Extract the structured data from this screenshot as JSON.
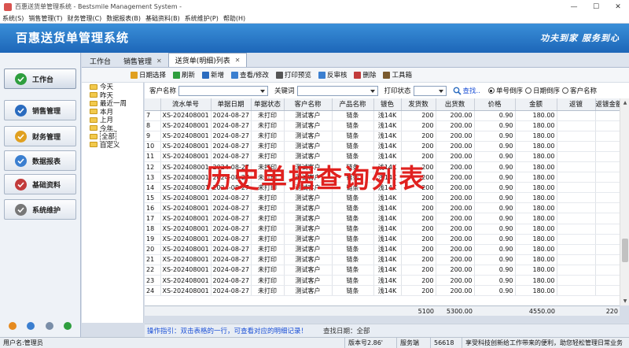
{
  "window": {
    "title": "百惠送货单管理系统 - Bestsmile Management System -",
    "min": "—",
    "max": "☐",
    "close": "✕"
  },
  "menu": [
    "系统(S)",
    "销售管理(T)",
    "财务管理(C)",
    "数据报表(B)",
    "基础资料(B)",
    "系统维护(P)",
    "帮助(H)"
  ],
  "banner": {
    "title": "百惠送货单管理系统",
    "slogan": "功夫到家 服务到心"
  },
  "nav": [
    {
      "label": "工作台",
      "icon": "check-circle-icon",
      "color": "#2e9e3e"
    },
    {
      "label": "销售管理",
      "icon": "cart-icon",
      "color": "#2a6bbf"
    },
    {
      "label": "财务管理",
      "icon": "folder-icon",
      "color": "#e0a020"
    },
    {
      "label": "数据报表",
      "icon": "magnifier-icon",
      "color": "#3b7fd0"
    },
    {
      "label": "基础资料",
      "icon": "user-icon",
      "color": "#c23b3b"
    },
    {
      "label": "系统维护",
      "icon": "gears-icon",
      "color": "#777777"
    }
  ],
  "tabs": [
    {
      "label": "工作台",
      "closable": false
    },
    {
      "label": "销售管理",
      "closable": true
    },
    {
      "label": "送货单(明细)列表",
      "closable": true
    }
  ],
  "toolbar": [
    {
      "label": "日期选择",
      "icon": "calendar-icon",
      "color": "#e0a020"
    },
    {
      "label": "刷新",
      "icon": "refresh-icon",
      "color": "#2e9e3e"
    },
    {
      "label": "新增",
      "icon": "add-icon",
      "color": "#2a6bbf"
    },
    {
      "label": "查看/修改",
      "icon": "edit-icon",
      "color": "#3b7fd0"
    },
    {
      "label": "打印预览",
      "icon": "print-icon",
      "color": "#555555"
    },
    {
      "label": "反审核",
      "icon": "undo-icon",
      "color": "#3b7fd0"
    },
    {
      "label": "删除",
      "icon": "delete-icon",
      "color": "#c23b3b"
    },
    {
      "label": "工具箱",
      "icon": "toolbox-icon",
      "color": "#7a5a2e"
    }
  ],
  "tree": [
    "今天",
    "昨天",
    "最近一周",
    "本月",
    "上月",
    "今年",
    "全部",
    "自定义"
  ],
  "tree_selected": "全部",
  "filter": {
    "customer_label": "客户名称",
    "keyword_label": "关键词",
    "print_label": "打印状态",
    "search_label": "查找..",
    "radios": [
      {
        "label": "单号倒序",
        "checked": true
      },
      {
        "label": "日期倒序",
        "checked": false
      },
      {
        "label": "客户名称",
        "checked": false
      }
    ]
  },
  "grid": {
    "headers": [
      "",
      "流水单号",
      "单据日期",
      "单据状态",
      "客户名称",
      "产品名称",
      "镀色",
      "发货数",
      "出货数",
      "价格",
      "金额",
      "返镀",
      "返镀金额"
    ],
    "rows": [
      [
        "7",
        "XS-202408001",
        "2024-08-27",
        "未打印",
        "测试客户",
        "链条",
        "浅14K",
        "200",
        "200.00",
        "0.90",
        "180.00",
        "",
        ""
      ],
      [
        "8",
        "XS-202408001",
        "2024-08-27",
        "未打印",
        "测试客户",
        "链条",
        "浅14K",
        "200",
        "200.00",
        "0.90",
        "180.00",
        "",
        ""
      ],
      [
        "9",
        "XS-202408001",
        "2024-08-27",
        "未打印",
        "测试客户",
        "链条",
        "浅14K",
        "200",
        "200.00",
        "0.90",
        "180.00",
        "",
        ""
      ],
      [
        "10",
        "XS-202408001",
        "2024-08-27",
        "未打印",
        "测试客户",
        "链条",
        "浅14K",
        "200",
        "200.00",
        "0.90",
        "180.00",
        "",
        ""
      ],
      [
        "11",
        "XS-202408001",
        "2024-08-27",
        "未打印",
        "测试客户",
        "链条",
        "浅14K",
        "200",
        "200.00",
        "0.90",
        "180.00",
        "",
        ""
      ],
      [
        "12",
        "XS-202408001",
        "2024-08-27",
        "未打印",
        "测试客户",
        "链条",
        "浅14K",
        "200",
        "200.00",
        "0.90",
        "180.00",
        "",
        ""
      ],
      [
        "13",
        "XS-202408001",
        "2024-08-27",
        "未打印",
        "测试客户",
        "链条",
        "浅14K",
        "200",
        "200.00",
        "0.90",
        "180.00",
        "",
        ""
      ],
      [
        "14",
        "XS-202408001",
        "2024-08-27",
        "未打印",
        "测试客户",
        "链条",
        "浅14K",
        "200",
        "200.00",
        "0.90",
        "180.00",
        "",
        ""
      ],
      [
        "15",
        "XS-202408001",
        "2024-08-27",
        "未打印",
        "测试客户",
        "链条",
        "浅14K",
        "200",
        "200.00",
        "0.90",
        "180.00",
        "",
        ""
      ],
      [
        "16",
        "XS-202408001",
        "2024-08-27",
        "未打印",
        "测试客户",
        "链条",
        "浅14K",
        "200",
        "200.00",
        "0.90",
        "180.00",
        "",
        ""
      ],
      [
        "17",
        "XS-202408001",
        "2024-08-27",
        "未打印",
        "测试客户",
        "链条",
        "浅14K",
        "200",
        "200.00",
        "0.90",
        "180.00",
        "",
        ""
      ],
      [
        "18",
        "XS-202408001",
        "2024-08-27",
        "未打印",
        "测试客户",
        "链条",
        "浅14K",
        "200",
        "200.00",
        "0.90",
        "180.00",
        "",
        ""
      ],
      [
        "19",
        "XS-202408001",
        "2024-08-27",
        "未打印",
        "测试客户",
        "链条",
        "浅14K",
        "200",
        "200.00",
        "0.90",
        "180.00",
        "",
        ""
      ],
      [
        "20",
        "XS-202408001",
        "2024-08-27",
        "未打印",
        "测试客户",
        "链条",
        "浅14K",
        "200",
        "200.00",
        "0.90",
        "180.00",
        "",
        ""
      ],
      [
        "21",
        "XS-202408001",
        "2024-08-27",
        "未打印",
        "测试客户",
        "链条",
        "浅14K",
        "200",
        "200.00",
        "0.90",
        "180.00",
        "",
        ""
      ],
      [
        "22",
        "XS-202408001",
        "2024-08-27",
        "未打印",
        "测试客户",
        "链条",
        "浅14K",
        "200",
        "200.00",
        "0.90",
        "180.00",
        "",
        ""
      ],
      [
        "23",
        "XS-202408001",
        "2024-08-27",
        "未打印",
        "测试客户",
        "链条",
        "浅14K",
        "200",
        "200.00",
        "0.90",
        "180.00",
        "",
        ""
      ],
      [
        "24",
        "XS-202408001",
        "2024-08-27",
        "未打印",
        "测试客户",
        "链条",
        "浅14K",
        "200",
        "200.00",
        "0.90",
        "180.00",
        "",
        ""
      ]
    ],
    "totals": [
      "",
      "",
      "",
      "",
      "",
      "",
      "",
      "5100",
      "5300.00",
      "",
      "4550.00",
      "",
      "220"
    ]
  },
  "hint": {
    "text": "操作指引：双击表格的一行，可查看对应的明细记录！",
    "date_label": "查找日期：全部"
  },
  "status": {
    "user": "用户名:管理员",
    "version": "版本号2.86'",
    "service": "服务端",
    "port": "56618",
    "message": "享受科技创新给工作带来的便利，助您轻松管理日常业务"
  },
  "watermark": "历史单据查询列表"
}
